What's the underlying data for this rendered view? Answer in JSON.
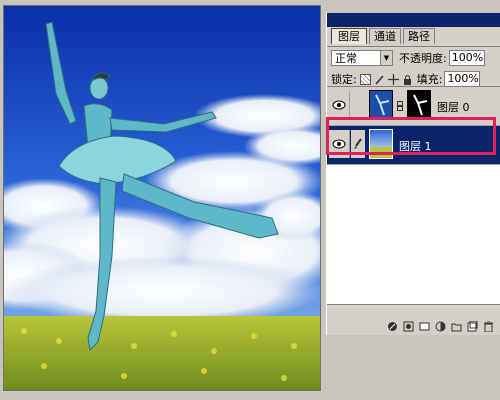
{
  "tabs": [
    "图层",
    "通道",
    "路径"
  ],
  "blend_mode": "正常",
  "opacity_label": "不透明度:",
  "opacity_value": "100%",
  "lock_label": "锁定:",
  "fill_label": "填充:",
  "fill_value": "100%",
  "layers": [
    {
      "name": "图层 0",
      "visible": true,
      "selected": false,
      "has_mask": true
    },
    {
      "name": "图层 1",
      "visible": true,
      "selected": true,
      "has_mask": false
    }
  ],
  "colors": {
    "palette_bg": "#d4d0c8",
    "selection": "#0a246a",
    "highlight_box": "#e0205a"
  },
  "icons": [
    "eye-icon",
    "brush-icon",
    "chain-link-icon",
    "lock-transparency-icon",
    "lock-paint-icon",
    "lock-move-icon",
    "lock-all-icon",
    "link-layers-icon",
    "layer-style-icon",
    "mask-icon",
    "new-group-icon",
    "adjustment-icon",
    "new-layer-icon",
    "trash-icon"
  ]
}
